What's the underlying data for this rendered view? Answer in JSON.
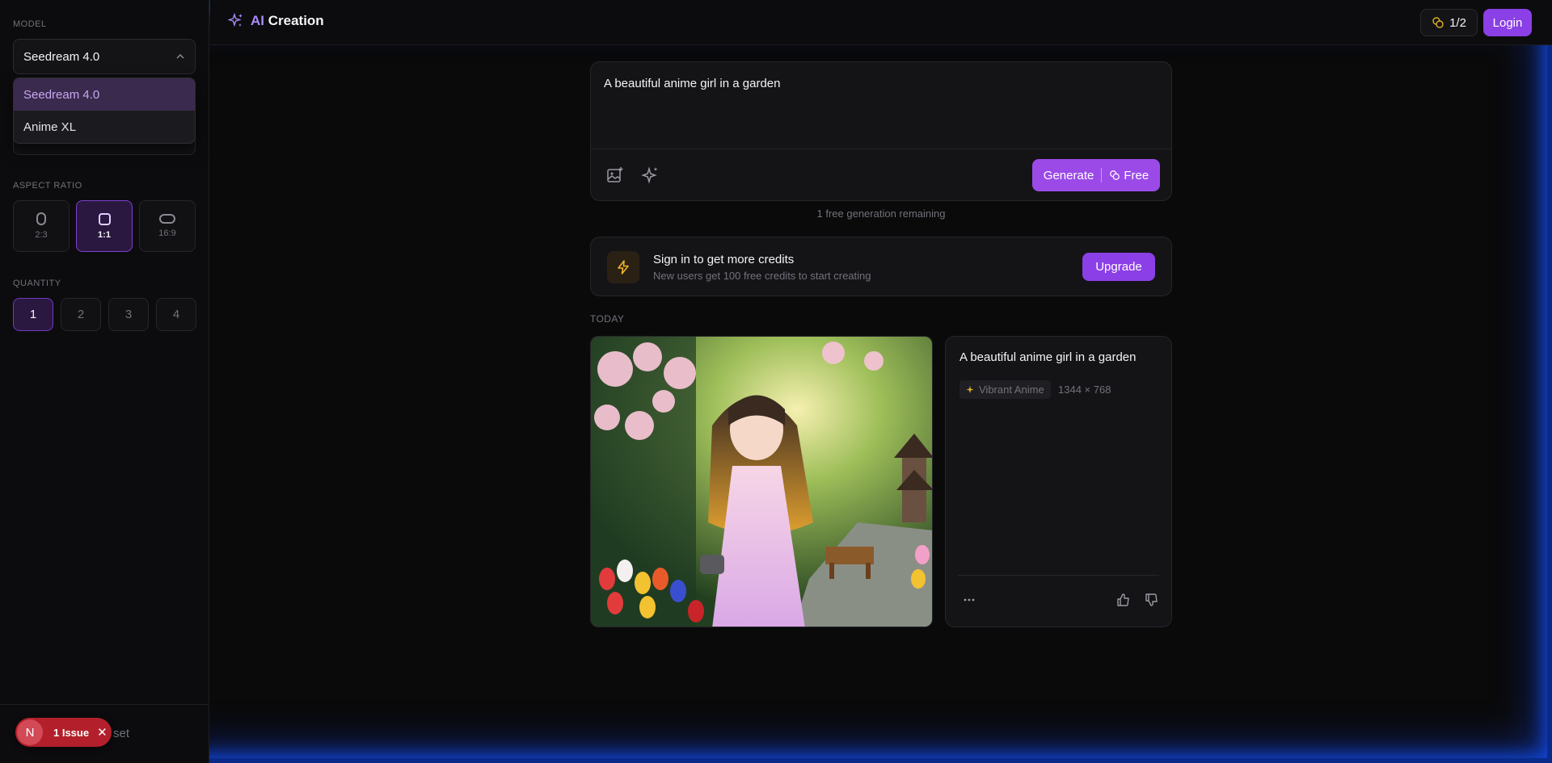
{
  "sidebar": {
    "model_label": "MODEL",
    "model_selected": "Seedream 4.0",
    "model_options": [
      "Seedream 4.0",
      "Anime XL"
    ],
    "aspect_label": "ASPECT RATIO",
    "aspects": [
      "2:3",
      "1:1",
      "16:9"
    ],
    "aspect_selected": "1:1",
    "quantity_label": "QUANTITY",
    "quantities": [
      "1",
      "2",
      "3",
      "4"
    ],
    "quantity_selected": "1",
    "reset_label": "set"
  },
  "issue_badge": {
    "avatar": "N",
    "label": "1 Issue"
  },
  "header": {
    "brand_ai": "AI",
    "brand_rest": "Creation",
    "credits": "1/2",
    "login_label": "Login"
  },
  "prompt": {
    "text": "A beautiful anime girl in a garden",
    "generate_label": "Generate",
    "free_label": "Free",
    "remaining": "1 free generation remaining"
  },
  "signin": {
    "title": "Sign in to get more credits",
    "subtitle": "New users get 100 free credits to start creating",
    "upgrade_label": "Upgrade"
  },
  "history": {
    "section_label": "TODAY",
    "item": {
      "prompt": "A beautiful anime girl in a garden",
      "style_tag": "Vibrant Anime",
      "dimensions": "1344 × 768"
    }
  },
  "colors": {
    "accent": "#8b3fe6",
    "accent_light": "#a78bfa",
    "issue": "#b3202b",
    "bolt": "#f0b429"
  }
}
